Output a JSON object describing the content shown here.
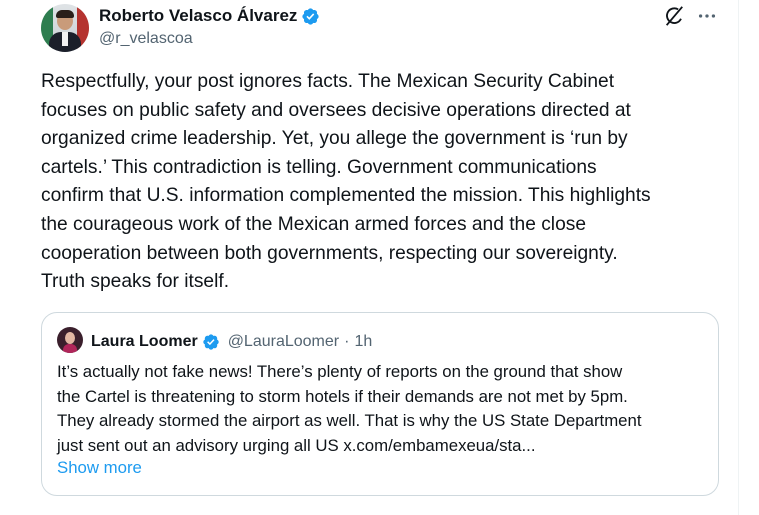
{
  "author": {
    "display_name": "Roberto Velasco Álvarez",
    "handle": "@r_velascoa",
    "verified": true,
    "verified_color": "#1d9bf0"
  },
  "actions": {
    "grok_icon": "grok-icon",
    "more_icon": "more-icon"
  },
  "post": {
    "text": "Respectfully, your post ignores facts. The Mexican Security Cabinet\nfocuses on public safety and oversees decisive operations directed at\norganized crime leadership. Yet, you allege the government is ‘run by\ncartels.’ This contradiction is telling. Government communications\nconfirm that U.S. information complemented the mission. This highlights\nthe courageous work of the Mexican armed forces and the close\ncooperation between both governments, respecting our sovereignty.\nTruth speaks for itself."
  },
  "quote": {
    "display_name": "Laura Loomer",
    "handle": "@LauraLoomer",
    "separator": "·",
    "time": "1h",
    "verified": true,
    "text": "It’s actually not fake news! There’s plenty of reports on the ground that show\nthe Cartel is threatening to storm hotels if their demands are not met by 5pm.\nThey already stormed the airport as well. That is why the US State Department\njust sent out an advisory urging all US x.com/embamexeua/sta...",
    "show_more": "Show more",
    "link_color": "#1d9bf0"
  }
}
